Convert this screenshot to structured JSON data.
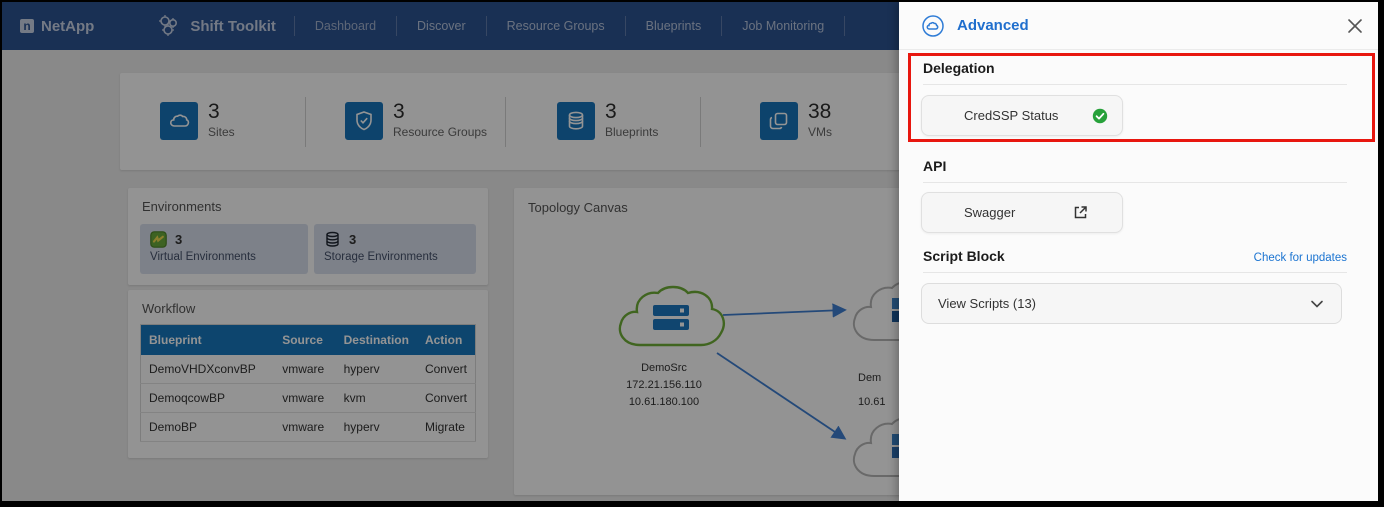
{
  "navbar": {
    "brand": "NetApp",
    "app_title": "Shift Toolkit",
    "items": [
      "Dashboard",
      "Discover",
      "Resource Groups",
      "Blueprints",
      "Job Monitoring"
    ]
  },
  "stats": {
    "items": [
      {
        "value": "3",
        "label": "Sites",
        "icon": "cloud-icon"
      },
      {
        "value": "3",
        "label": "Resource Groups",
        "icon": "shield-check-icon"
      },
      {
        "value": "3",
        "label": "Blueprints",
        "icon": "database-icon"
      },
      {
        "value": "38",
        "label": "VMs",
        "icon": "vm-layers-icon"
      }
    ]
  },
  "environments": {
    "title": "Environments",
    "tiles": [
      {
        "count": "3",
        "label": "Virtual Environments",
        "icon": "vsphere-icon"
      },
      {
        "count": "3",
        "label": "Storage Environments",
        "icon": "storage-stack-icon"
      }
    ]
  },
  "workflow": {
    "title": "Workflow",
    "headers": [
      "Blueprint",
      "Source",
      "Destination",
      "Action"
    ],
    "rows": [
      [
        "DemoVHDXconvBP",
        "vmware",
        "hyperv",
        "Convert"
      ],
      [
        "DemoqcowBP",
        "vmware",
        "kvm",
        "Convert"
      ],
      [
        "DemoBP",
        "vmware",
        "hyperv",
        "Migrate"
      ]
    ]
  },
  "topology": {
    "title": "Topology Canvas",
    "source_node": {
      "name": "DemoSrc",
      "ip1": "172.21.156.110",
      "ip2": "10.61.180.100"
    },
    "dest_node_partial": {
      "name": "Dem",
      "ip": "10.61"
    }
  },
  "panel": {
    "title": "Advanced",
    "delegation": {
      "heading": "Delegation",
      "button_label": "CredSSP Status"
    },
    "api": {
      "heading": "API",
      "button_label": "Swagger"
    },
    "script_block": {
      "heading": "Script Block",
      "link": "Check for updates",
      "dropdown_label": "View Scripts (13)"
    }
  },
  "colors": {
    "navbar_bg": "#2c5391",
    "accent_blue": "#1878be",
    "panel_title_blue": "#1f6ecd",
    "success_green": "#27a13a",
    "annotation_red": "#e8170f",
    "link_blue": "#1b74d1",
    "topology_source_green": "#6fae37"
  }
}
